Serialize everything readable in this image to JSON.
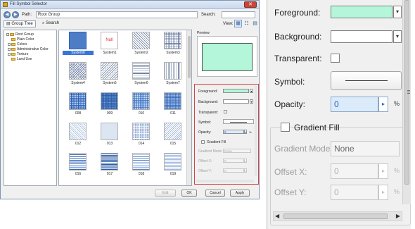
{
  "dialog": {
    "title": "Fill Symbol Selector",
    "close_glyph": "✕",
    "nav_back_glyph": "◀",
    "nav_forward_glyph": "▶",
    "path_label": "Path:",
    "path_value": "Root Group",
    "search_label": "Search:",
    "search_value": "",
    "tabs": {
      "group_tree": "Group Tree",
      "search": "Search"
    },
    "view_label": "View:",
    "view_buttons": [
      "▦",
      "☷",
      "▤"
    ],
    "tree": {
      "root": "Root Group",
      "children": [
        "Plain Color",
        "Colors",
        "Administrative Color",
        "Texture",
        "Land Use"
      ]
    },
    "symbols": [
      {
        "label": "System0",
        "pattern": "dense-blue",
        "selected": true
      },
      {
        "label": "System1",
        "pattern": "null",
        "text": "Null"
      },
      {
        "label": "System2",
        "pattern": "diag-fwd"
      },
      {
        "label": "System3",
        "pattern": "grid"
      },
      {
        "label": "System4",
        "pattern": "cross-diag"
      },
      {
        "label": "System5",
        "pattern": "diag-back"
      },
      {
        "label": "System6",
        "pattern": "horiz"
      },
      {
        "label": "System7",
        "pattern": "vert"
      },
      {
        "label": "008",
        "pattern": "blue-dots"
      },
      {
        "label": "009",
        "pattern": "blue-dots-dense"
      },
      {
        "label": "010",
        "pattern": "blue-dots-light"
      },
      {
        "label": "011",
        "pattern": "blue-dots-medium"
      },
      {
        "label": "012",
        "pattern": "light-diag"
      },
      {
        "label": "013",
        "pattern": "light-dots"
      },
      {
        "label": "014",
        "pattern": "light-dots-2"
      },
      {
        "label": "015",
        "pattern": "light-diag-2"
      },
      {
        "label": "016",
        "pattern": "blue-horiz"
      },
      {
        "label": "017",
        "pattern": "blue-horiz-dense"
      },
      {
        "label": "018",
        "pattern": "blue-horiz-light"
      },
      {
        "label": "019",
        "pattern": "blue-horiz-thin"
      },
      {
        "label": "",
        "pattern": "blue-vert"
      },
      {
        "label": "",
        "pattern": "blue-vert-dense"
      },
      {
        "label": "",
        "pattern": "blue-vert-light"
      },
      {
        "label": "",
        "pattern": "blue-vert-thin"
      }
    ],
    "preview_label": "Preview",
    "buttons": {
      "edit": "Edit",
      "ok": "OK",
      "cancel": "Cancel",
      "apply": "Apply"
    }
  },
  "properties": {
    "foreground_label": "Foreground:",
    "foreground_color": "#b4f6d9",
    "background_label": "Background:",
    "background_color": "#ffffff",
    "transparent_label": "Transparent:",
    "symbol_label": "Symbol:",
    "opacity_label": "Opacity:",
    "opacity_value": "0",
    "opacity_unit": "%",
    "gradient_fill_label": "Gradient Fill",
    "gradient_mode_label": "Gradient Mode:",
    "gradient_mode_value": "None",
    "offset_x_label": "Offset X:",
    "offset_x_value": "0",
    "offset_y_label": "Offset Y:",
    "offset_y_value": "0",
    "unit": "%",
    "dropdown_glyph": "▾",
    "spin_glyph": "▸",
    "scroll_left_glyph": "◀",
    "scroll_right_glyph": "▶"
  }
}
